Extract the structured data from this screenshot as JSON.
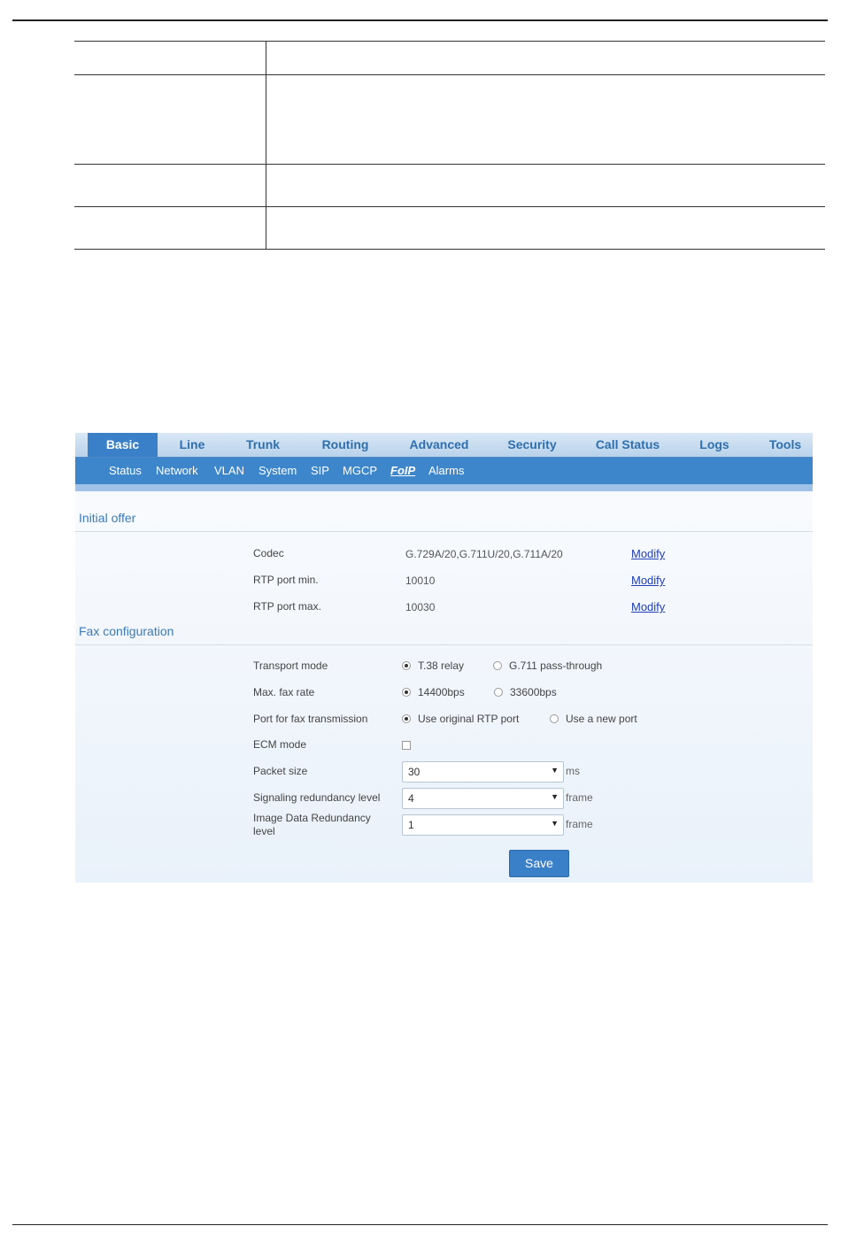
{
  "document": {
    "table_rows": [
      {
        "label": "",
        "desc": ""
      },
      {
        "label": "",
        "desc": ""
      },
      {
        "label": "",
        "desc": ""
      },
      {
        "label": "",
        "desc": ""
      }
    ]
  },
  "nav": {
    "tabs": [
      "Basic",
      "Line",
      "Trunk",
      "Routing",
      "Advanced",
      "Security",
      "Call Status",
      "Logs",
      "Tools"
    ],
    "active_tab": "Basic",
    "subtabs": [
      "Status",
      "Network",
      "VLAN",
      "System",
      "SIP",
      "MGCP",
      "FoIP",
      "Alarms"
    ],
    "active_subtab": "FoIP"
  },
  "initial_offer": {
    "title": "Initial offer",
    "rows": [
      {
        "label": "Codec",
        "value": "G.729A/20,G.711U/20,G.711A/20",
        "action": "Modify"
      },
      {
        "label": "RTP port min.",
        "value": "10010",
        "action": "Modify"
      },
      {
        "label": "RTP port max.",
        "value": "10030",
        "action": "Modify"
      }
    ]
  },
  "fax": {
    "title": "Fax configuration",
    "transport_mode": {
      "label": "Transport mode",
      "options": [
        "T.38 relay",
        "G.711 pass-through"
      ],
      "selected": "T.38 relay"
    },
    "max_fax_rate": {
      "label": "Max. fax rate",
      "options": [
        "14400bps",
        "33600bps"
      ],
      "selected": "14400bps"
    },
    "port": {
      "label": "Port for fax transmission",
      "options": [
        "Use original RTP port",
        "Use a new port"
      ],
      "selected": "Use original RTP port"
    },
    "ecm": {
      "label": "ECM mode",
      "checked": false
    },
    "packet_size": {
      "label": "Packet size",
      "value": "30",
      "unit": "ms"
    },
    "signaling_redundancy": {
      "label": "Signaling redundancy level",
      "value": "4",
      "unit": "frame"
    },
    "image_redundancy": {
      "label": "Image Data Redundancy level",
      "value": "1",
      "unit": "frame"
    }
  },
  "save_label": "Save",
  "colors": {
    "accent": "#3a80c8",
    "link": "#1f3fb6",
    "section_title": "#3a7ab9"
  }
}
